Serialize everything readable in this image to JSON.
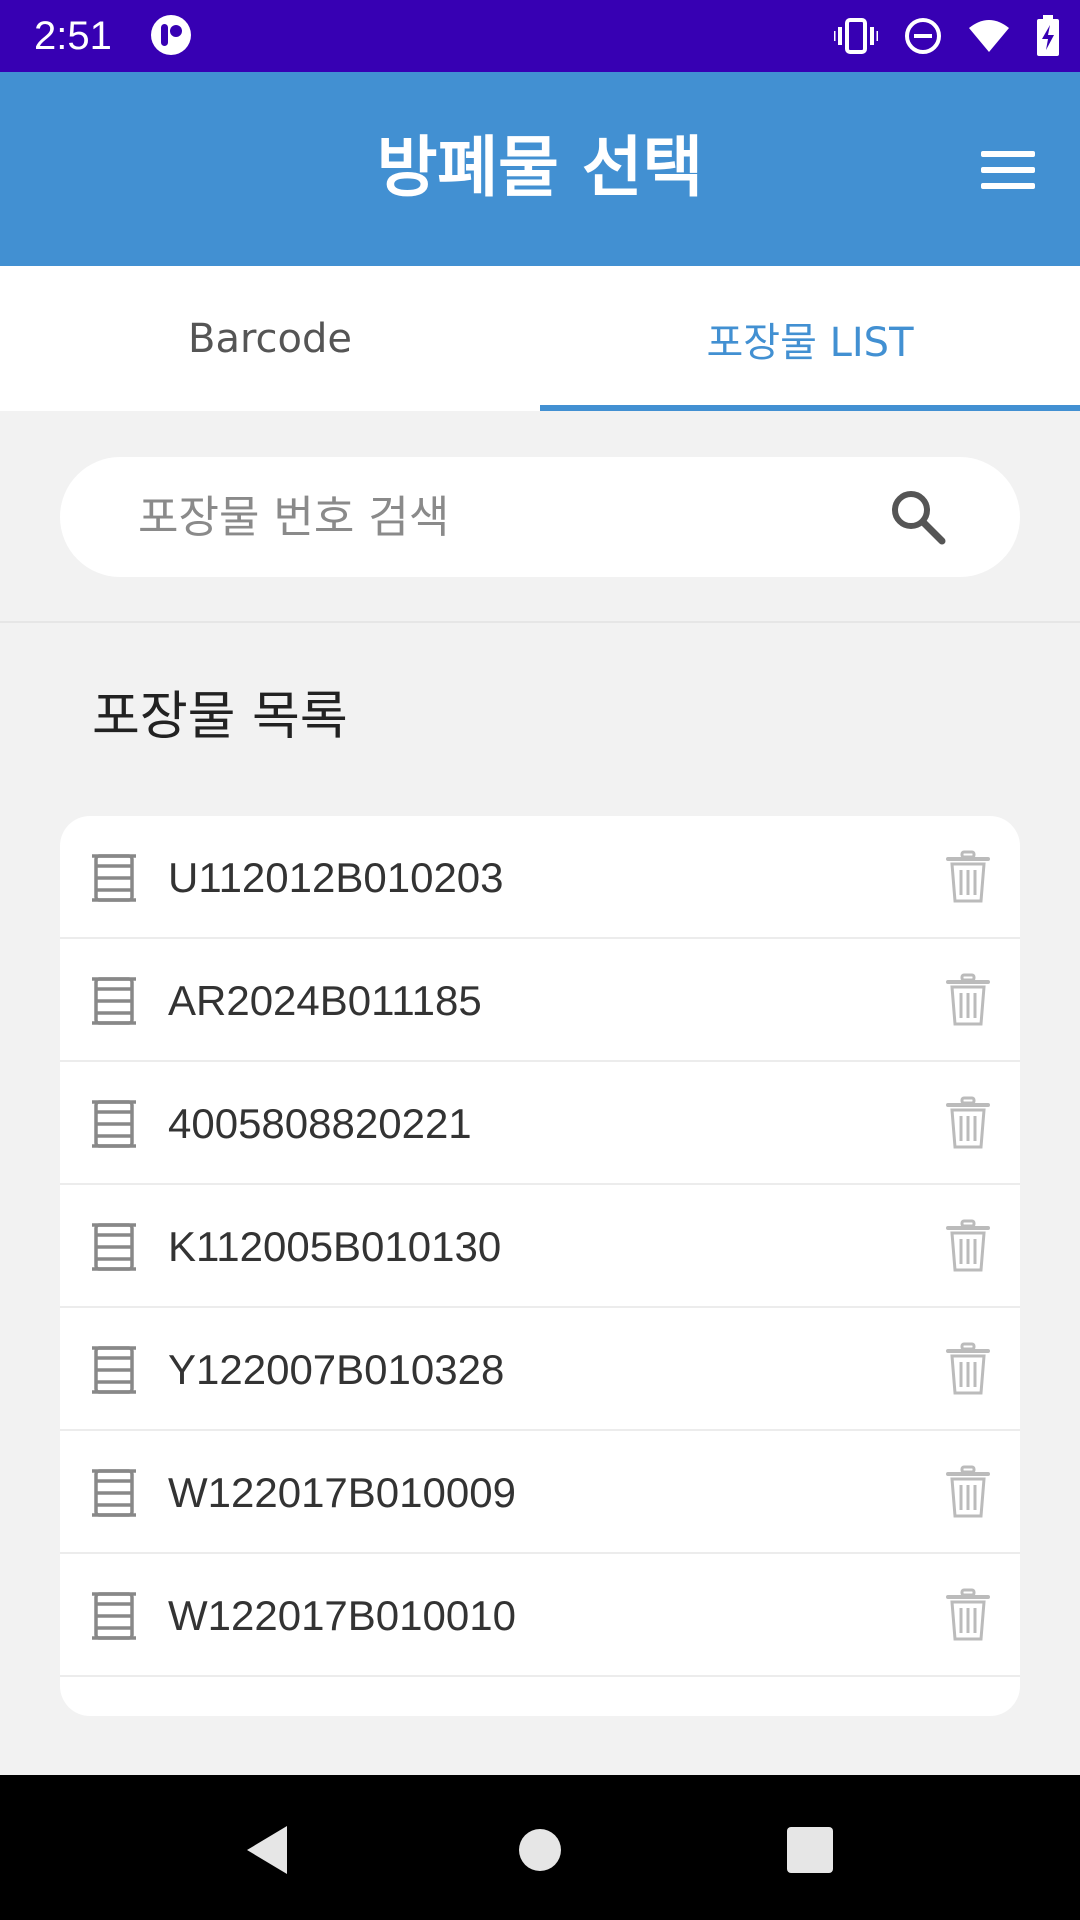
{
  "status_bar": {
    "time": "2:51",
    "icons": [
      "app-notification-icon",
      "vibrate-icon",
      "do-not-disturb-icon",
      "wifi-icon",
      "battery-charging-icon"
    ]
  },
  "app_bar": {
    "title": "방폐물 선택",
    "menu_icon": "hamburger-menu-icon",
    "background": "#4290d2"
  },
  "tabs": [
    {
      "label": "Barcode",
      "active": false
    },
    {
      "label": "포장물 LIST",
      "active": true
    }
  ],
  "search": {
    "placeholder": "포장물 번호 검색",
    "value": "",
    "icon": "search-icon"
  },
  "list": {
    "heading": "포장물 목록",
    "item_icon": "drum-icon",
    "delete_icon": "trash-icon",
    "items": [
      {
        "id": "U112012B010203"
      },
      {
        "id": "AR2024B011185"
      },
      {
        "id": "4005808820221"
      },
      {
        "id": "K112005B010130"
      },
      {
        "id": "Y122007B010328"
      },
      {
        "id": "W122017B010009"
      },
      {
        "id": "W122017B010010"
      }
    ]
  },
  "nav_bar": {
    "buttons": [
      "back-icon",
      "home-icon",
      "recents-icon"
    ]
  },
  "colors": {
    "status_bar": "#3700b3",
    "accent": "#4290d2",
    "background": "#f2f2f2"
  }
}
